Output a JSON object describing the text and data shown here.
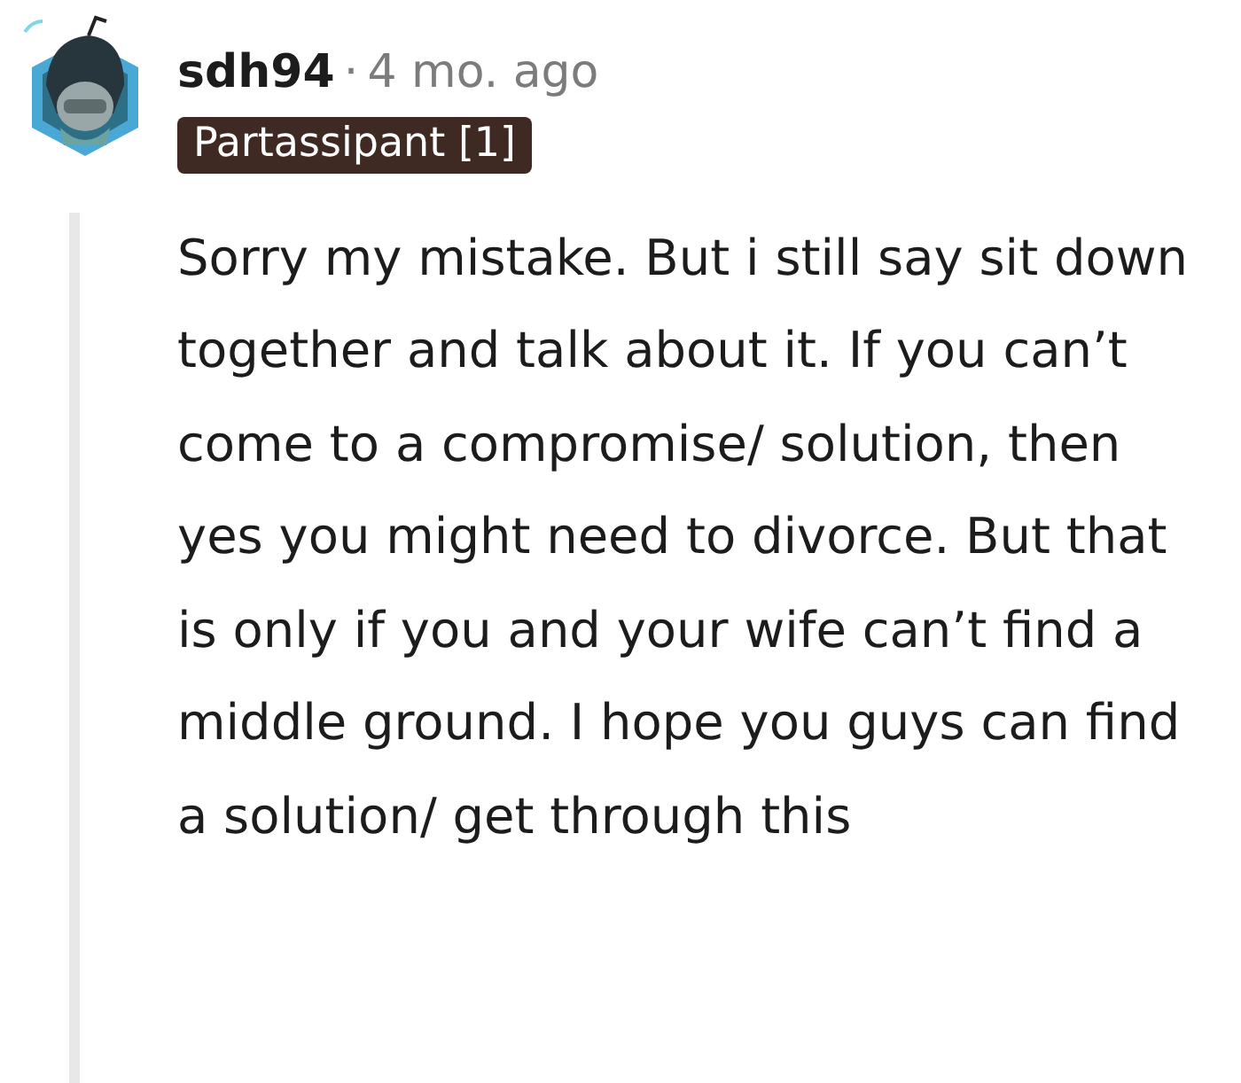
{
  "comment": {
    "author": "sdh94",
    "separator": "·",
    "time": "4 mo. ago",
    "flair": "Partassipant [1]",
    "body": "Sorry my mistake. But i still say sit down together and talk about it. If you can’t come to a compromise/ solution, then yes you might need to divorce. But that is only if you and your wife can’t find a middle ground. I hope you guys can find a solution/ get through this"
  }
}
